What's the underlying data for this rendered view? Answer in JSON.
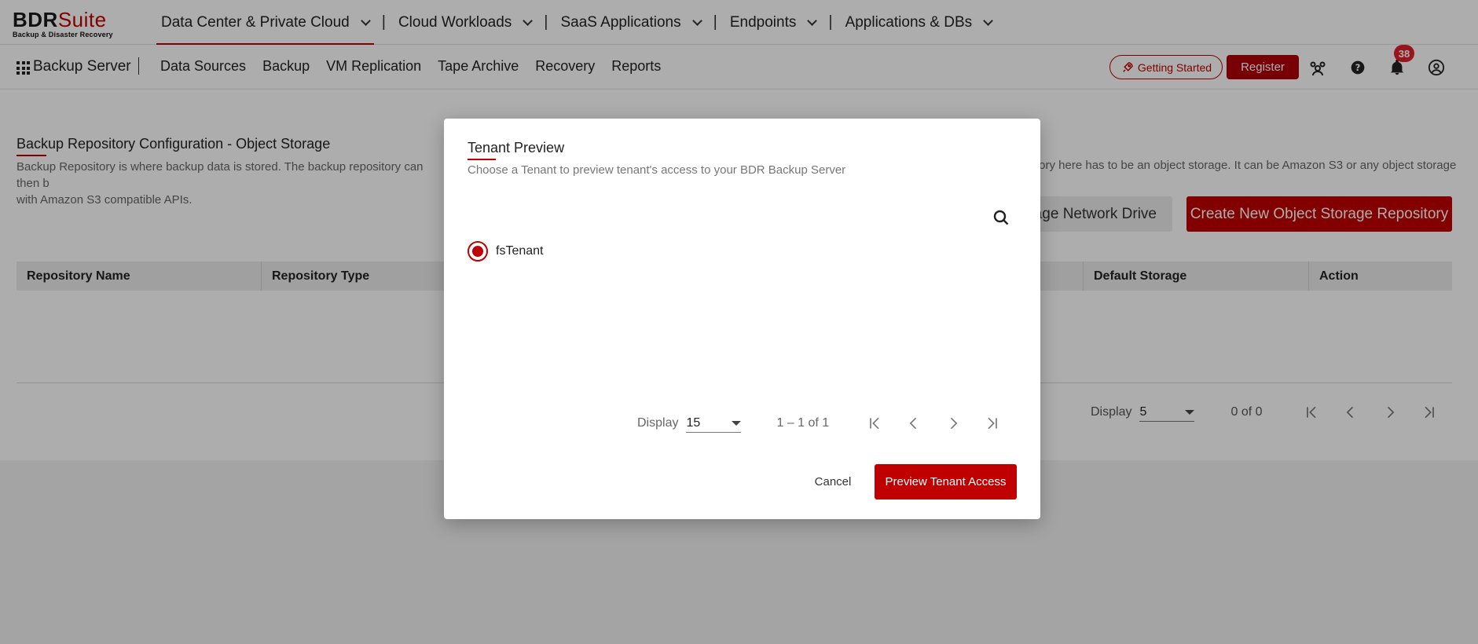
{
  "logo": {
    "brand_a": "BDR",
    "brand_b": "Suite",
    "tagline": "Backup & Disaster Recovery"
  },
  "top_menu": [
    {
      "label": "Data Center & Private Cloud",
      "active": true
    },
    {
      "label": "Cloud Workloads"
    },
    {
      "label": "SaaS Applications"
    },
    {
      "label": "Endpoints"
    },
    {
      "label": "Applications & DBs"
    }
  ],
  "top_separator": "|",
  "sub_nav": {
    "server": "Backup Server",
    "items": [
      "Data Sources",
      "Backup",
      "VM Replication",
      "Tape Archive",
      "Recovery",
      "Reports"
    ]
  },
  "header_actions": {
    "getting_started": "Getting Started",
    "register": "Register",
    "notification_count": "38"
  },
  "page": {
    "title": "Backup Repository Configuration - Object Storage",
    "description_left": "Backup Repository is where backup data is stored. The backup repository can then b",
    "description_left_line2": "with Amazon S3 compatible APIs.",
    "description_right": "tory here has to be an object storage. It can be Amazon S3 or any object storage",
    "manage_network_drive": "nage Network Drive",
    "create_repository": "Create New Object Storage Repository",
    "columns": [
      "Repository Name",
      "Repository Type",
      "Default Storage",
      "Action"
    ],
    "pager": {
      "display_label": "Display",
      "page_size": "5",
      "range": "0 of 0"
    }
  },
  "modal": {
    "title": "Tenant Preview",
    "subtitle": "Choose a Tenant to preview tenant's access to your BDR Backup Server",
    "tenants": [
      {
        "name": "fsTenant",
        "selected": true
      }
    ],
    "pager": {
      "display_label": "Display",
      "page_size": "15",
      "range": "1 – 1 of 1"
    },
    "cancel": "Cancel",
    "preview": "Preview Tenant Access"
  },
  "colors": {
    "accent": "#c00000"
  }
}
